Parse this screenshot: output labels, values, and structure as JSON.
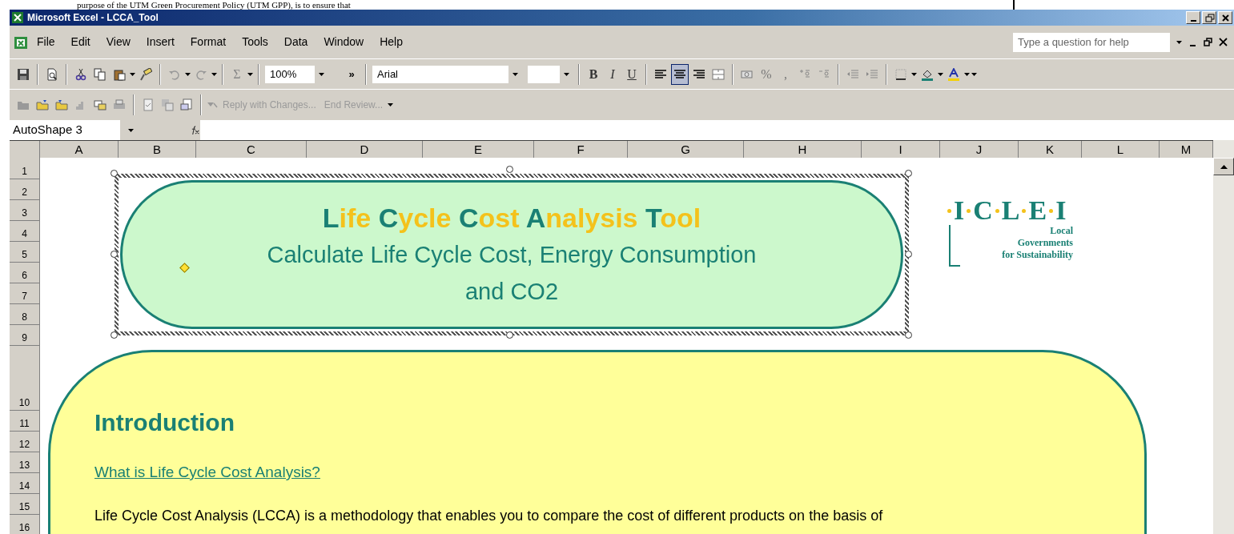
{
  "background_document": {
    "text": "purpose of the UTM Green Procurement Policy (UTM GPP), is to ensure that"
  },
  "window": {
    "title": "Microsoft Excel - LCCA_Tool"
  },
  "menu": [
    {
      "label": "File"
    },
    {
      "label": "Edit"
    },
    {
      "label": "View"
    },
    {
      "label": "Insert"
    },
    {
      "label": "Format"
    },
    {
      "label": "Tools"
    },
    {
      "label": "Data"
    },
    {
      "label": "Window"
    },
    {
      "label": "Help"
    }
  ],
  "help_box": {
    "placeholder": "Type a question for help"
  },
  "standard_toolbar": {
    "sum_symbol": "Σ",
    "zoom": "100%",
    "more": "»"
  },
  "formatting_toolbar": {
    "font": "Arial",
    "bold": "B",
    "italic": "I",
    "underline": "U",
    "align_buttons": [
      {
        "selected": false
      },
      {
        "selected": true
      },
      {
        "selected": false
      }
    ],
    "percent": "%",
    "comma": ","
  },
  "reviewing_toolbar": [
    {
      "label": "Reply with Changes...",
      "disabled": true
    },
    {
      "label": "End Review...",
      "disabled": true
    }
  ],
  "formula_bar": {
    "name_box": "AutoShape 3"
  },
  "columns": [
    "A",
    "B",
    "C",
    "D",
    "E",
    "F",
    "G",
    "H",
    "I",
    "J",
    "K",
    "L",
    "M"
  ],
  "rows": [
    "1",
    "2",
    "3",
    "4",
    "5",
    "6",
    "7",
    "8",
    "9",
    "10",
    "11",
    "12",
    "13",
    "14",
    "15",
    "16"
  ],
  "title_shape": {
    "selected": true,
    "title": [
      {
        "text": "L",
        "color": "#1a8074"
      },
      {
        "text": "ife ",
        "color": "#f4c21b"
      },
      {
        "text": "C",
        "color": "#1a8074"
      },
      {
        "text": "ycle ",
        "color": "#f4c21b"
      },
      {
        "text": "C",
        "color": "#1a8074"
      },
      {
        "text": "ost ",
        "color": "#f4c21b"
      },
      {
        "text": "A",
        "color": "#1a8074"
      },
      {
        "text": "nalysis ",
        "color": "#f4c21b"
      },
      {
        "text": "T",
        "color": "#1a8074"
      },
      {
        "text": "ool",
        "color": "#f4c21b"
      }
    ],
    "subtitle": "Calculate Life Cycle Cost, Energy Consumption and CO2"
  },
  "logo": {
    "letters": [
      "I",
      "C",
      "L",
      "E",
      "I"
    ],
    "lines": [
      "Local",
      "Governments",
      "for Sustainability"
    ]
  },
  "intro_shape": {
    "heading": "Introduction",
    "link": "What is Life Cycle Cost Analysis?",
    "paragraph": "Life Cycle Cost Analysis (LCCA) is a methodology that enables you to compare the cost of different products on the basis of"
  }
}
